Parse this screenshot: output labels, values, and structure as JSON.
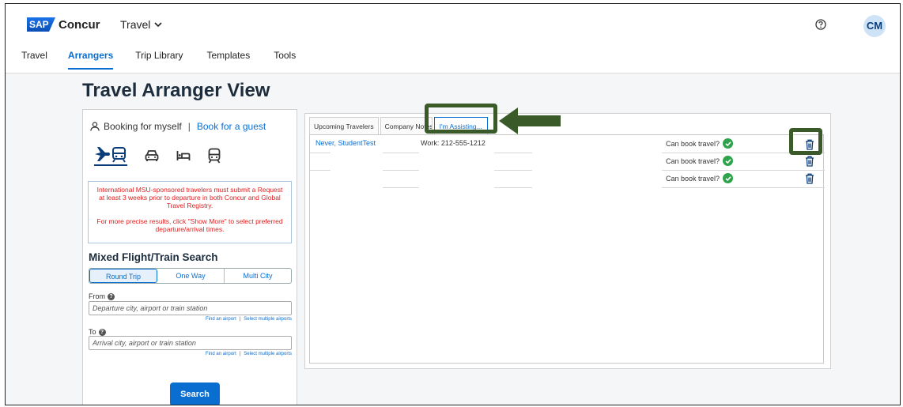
{
  "header": {
    "logo_sap": "SAP",
    "logo_text": "Concur",
    "product_menu": "Travel",
    "avatar_initials": "CM"
  },
  "nav": {
    "items": [
      {
        "label": "Travel",
        "active": false
      },
      {
        "label": "Arrangers",
        "active": true
      },
      {
        "label": "Trip Library",
        "active": false
      },
      {
        "label": "Templates",
        "active": false
      },
      {
        "label": "Tools",
        "active": false
      }
    ]
  },
  "page": {
    "title": "Travel Arranger View"
  },
  "booking": {
    "for_myself": "Booking for myself",
    "separator": "|",
    "for_guest": "Book for a guest",
    "modes": [
      "flight-train-icon",
      "car-icon",
      "hotel-icon",
      "rail-icon"
    ]
  },
  "notice": {
    "line1": "International MSU-sponsored travelers must submit a Request at least 3 weeks prior to departure in both Concur and Global Travel Registry.",
    "line2": "For more precise results, click \"Show More\" to select preferred departure/arrival times."
  },
  "search": {
    "title": "Mixed Flight/Train Search",
    "trip_types": [
      "Round Trip",
      "One Way",
      "Multi City"
    ],
    "selected_trip_type": "Round Trip",
    "from_label": "From",
    "from_placeholder": "Departure city, airport or train station",
    "to_label": "To",
    "to_placeholder": "Arrival city, airport or train station",
    "find_airport": "Find an airport",
    "helper_sep": "|",
    "select_multiple": "Select multiple airports",
    "search_button": "Search"
  },
  "tabs": {
    "upcoming": "Upcoming Travelers",
    "company_notes": "Company Notes",
    "assisting": "I'm Assisting..."
  },
  "assisting": {
    "rows": [
      {
        "name": "Never, StudentTest",
        "phone": "Work: 212-555-1212",
        "can_book": "Can book travel?"
      },
      {
        "name": "",
        "phone": "",
        "can_book": "Can book travel?"
      },
      {
        "name": "",
        "phone": "",
        "can_book": "Can book travel?"
      }
    ]
  },
  "colors": {
    "accent": "#0a6ed1",
    "highlight": "#3b5a2a",
    "check": "#2ea34b",
    "notice_text": "#e02020"
  }
}
